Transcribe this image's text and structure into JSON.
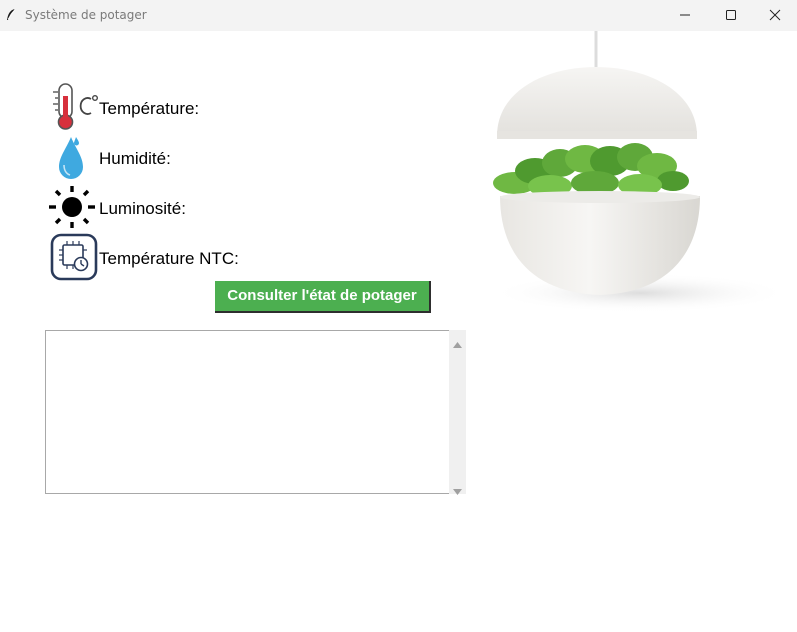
{
  "window": {
    "title": "Système de potager"
  },
  "sensors": [
    {
      "label": "Température:",
      "icon": "thermometer-icon"
    },
    {
      "label": "Humidité:",
      "icon": "water-drop-icon"
    },
    {
      "label": "Luminosité:",
      "icon": "sun-icon"
    },
    {
      "label": "Température NTC:",
      "icon": "ntc-chip-icon"
    }
  ],
  "actions": {
    "consult_label": "Consulter l'état de potager"
  },
  "output": {
    "text": ""
  },
  "colors": {
    "button_background": "#4caf50",
    "button_text": "#ffffff",
    "title_bar": "#f3f3f3",
    "drop_blue": "#3fa9e0",
    "thermometer_red": "#d7303c"
  }
}
